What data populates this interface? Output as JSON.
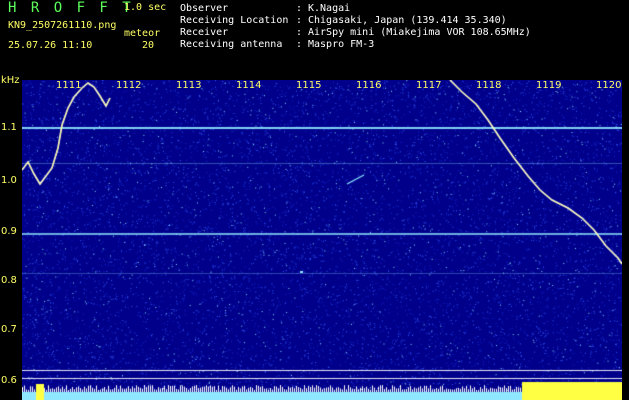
{
  "header": {
    "app_title": "H R O F F T",
    "seconds_label": "1.0 sec",
    "filename": "KN9_2507261110.png",
    "mode_label": "meteor",
    "timestamp": "25.07.26 11:10",
    "count": "20"
  },
  "info": [
    {
      "label": "Observer",
      "value": "K.Nagai"
    },
    {
      "label": "Receiving Location",
      "value": "Chigasaki, Japan (139.414 35.340)"
    },
    {
      "label": "Receiver",
      "value": "AirSpy mini (Miakejima VOR 108.65MHz)"
    },
    {
      "label": "Receiving antenna",
      "value": "Maspro FM-3"
    }
  ],
  "info_separator": ":",
  "y_unit": "kHz",
  "y_ticks": [
    "1.1",
    "1.0",
    "0.9",
    "0.8",
    "0.7",
    "0.6"
  ],
  "x_ticks": [
    "1111",
    "1112",
    "1113",
    "1114",
    "1115",
    "1116",
    "1117",
    "1118",
    "1119",
    "1120"
  ],
  "colors": {
    "background": "#000000",
    "plot_background": "#00008a",
    "noise_blue": "#3a5cff",
    "noise_cyan": "#8fe8ff",
    "signal_white": "#ffffff",
    "signal_yellow": "#ffff44",
    "label_green": "#5cff5c",
    "label_yellow": "#ffff66"
  }
}
